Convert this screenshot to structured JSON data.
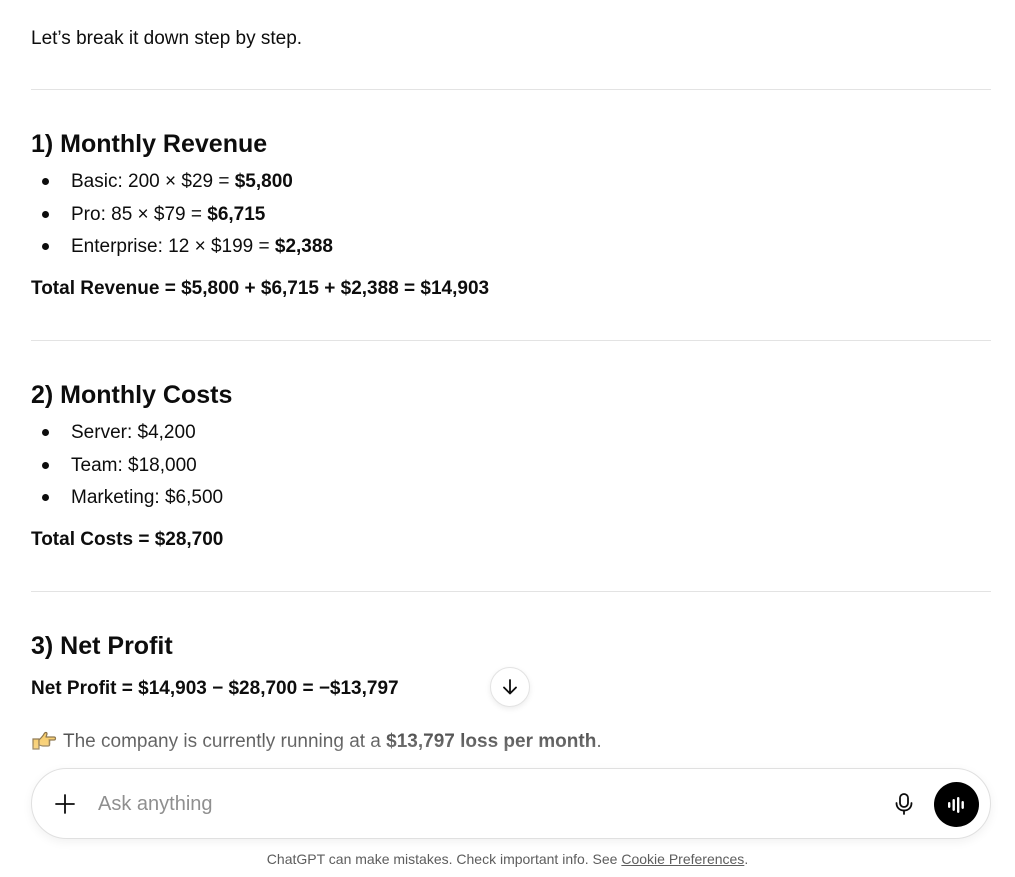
{
  "intro": "Let’s break it down step by step.",
  "sections": [
    {
      "heading": "1) Monthly Revenue",
      "items": [
        {
          "label": "Basic: 200 × $29 = ",
          "value": "$5,800"
        },
        {
          "label": "Pro: 85 × $79 = ",
          "value": "$6,715"
        },
        {
          "label": "Enterprise: 12 × $199 = ",
          "value": "$2,388"
        }
      ],
      "total": "Total Revenue = $5,800 + $6,715 + $2,388 = $14,903"
    },
    {
      "heading": "2) Monthly Costs",
      "items": [
        {
          "label": "Server: $4,200",
          "value": ""
        },
        {
          "label": "Team: $18,000",
          "value": ""
        },
        {
          "label": "Marketing: $6,500",
          "value": ""
        }
      ],
      "total": "Total Costs = $28,700"
    },
    {
      "heading": "3) Net Profit",
      "total": "Net Profit = $14,903 − $28,700 = −$13,797"
    }
  ],
  "conclusion": {
    "icon": "pointing-hand-emoji",
    "text_before": "The company is currently running at a ",
    "text_bold": "$13,797 loss per month",
    "text_after": "."
  },
  "composer": {
    "placeholder": "Ask anything",
    "value": "",
    "plus_icon": "plus-icon",
    "mic_icon": "microphone-icon",
    "voice_icon": "voice-mode-icon"
  },
  "footer": {
    "text": "ChatGPT can make mistakes. Check important info. See ",
    "link": "Cookie Preferences",
    "end": "."
  },
  "colors": {
    "text": "#0d0d0d",
    "divider": "#e3e3e3",
    "voice_button": "#000000",
    "footer_text": "#5d5d5d",
    "emoji_hand": "#f5b82e"
  }
}
